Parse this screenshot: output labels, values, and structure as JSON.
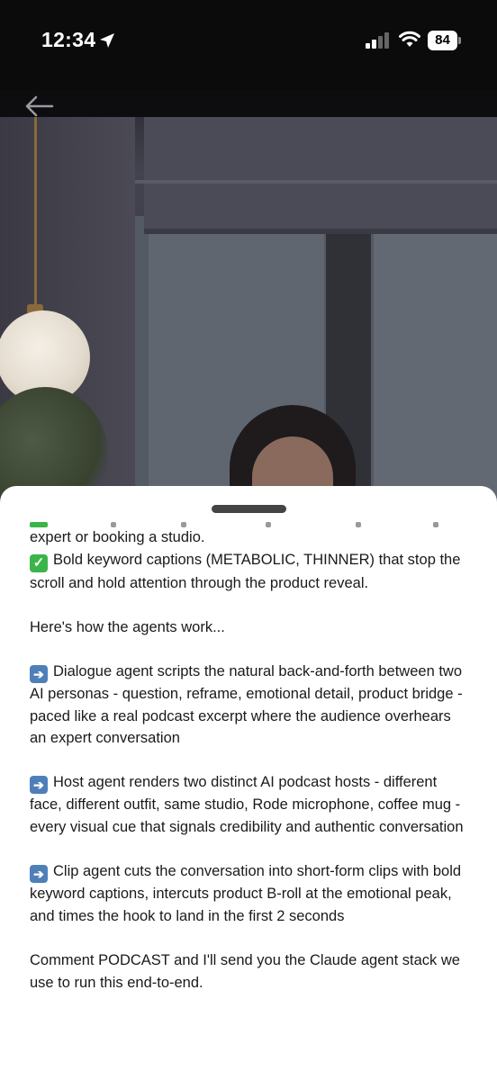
{
  "status_bar": {
    "time": "12:34",
    "battery": "84",
    "icons": [
      "location-arrow-icon",
      "cellular-signal-icon",
      "wifi-icon",
      "battery-icon"
    ]
  },
  "video": {
    "back_icon": "back-arrow-icon"
  },
  "post": {
    "lines": [
      "expert or booking a studio.",
      "Bold keyword captions (METABOLIC, THINNER) that stop the scroll and hold attention through the product reveal.",
      "Here's how the agents work...",
      "Dialogue agent scripts the natural back-and-forth between two AI personas - question, reframe, emotional detail, product bridge - paced like a real podcast excerpt where the audience overhears an expert conversation",
      "Host agent renders two distinct AI podcast hosts - different face, different outfit, same studio, Rode microphone, coffee mug - every visual cue that signals credibility and authentic conversation",
      "Clip agent cuts the conversation into short-form clips with bold keyword captions, intercuts product B-roll at the emotional peak, and times the hook to land in the first 2 seconds",
      "Comment PODCAST and I'll send you the Claude agent stack we use to run this end-to-end."
    ]
  },
  "colors": {
    "check_green": "#3bb54a",
    "arrow_blue": "#4f7fb8",
    "sheet_bg": "#ffffff",
    "text": "#1a1a1a"
  }
}
